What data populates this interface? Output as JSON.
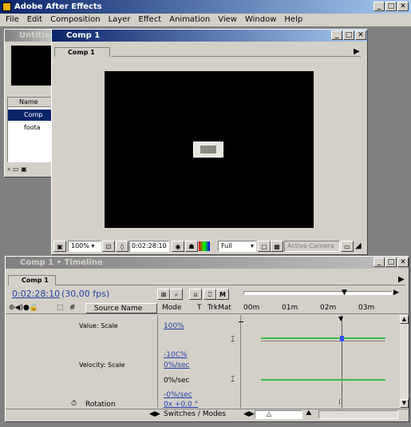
{
  "app": {
    "title": "Adobe After Effects"
  },
  "menu": [
    "File",
    "Edit",
    "Composition",
    "Layer",
    "Effect",
    "Animation",
    "View",
    "Window",
    "Help"
  ],
  "project": {
    "title": "Untitled",
    "col_name": "Name",
    "items": [
      "Comp",
      "foota"
    ]
  },
  "comp_window": {
    "title": "Comp 1",
    "tab": "Comp 1",
    "zoom": "100%",
    "timecode": "0:02:28:10",
    "resolution": "Full",
    "camera": "Active Camera"
  },
  "timeline": {
    "title": "Comp 1 • Timeline",
    "tab": "Comp 1",
    "current_time": "0:02:28:10",
    "fps": "(30,00 fps)",
    "headers": {
      "hash": "#",
      "source": "Source Name",
      "mode": "Mode",
      "t": "T",
      "trkmat": "TrkMat"
    },
    "ruler": [
      "00m",
      "01m",
      "02m",
      "03m"
    ],
    "rows": {
      "value_scale": {
        "label": "Value: Scale",
        "value": "100%"
      },
      "velocity_scale": {
        "label": "Velocity: Scale",
        "v1": "-10C%",
        "v2": "0%/sec",
        "v3": "0%/sec"
      },
      "rotation": {
        "label": "Rotation",
        "v1": "-0%/sec",
        "v2": "0x +0.0 °"
      }
    },
    "footer": "Switches / Modes"
  },
  "colors": {
    "title_active": "#0a246a",
    "curve": "#3cb846",
    "value_text": "#1f3ea8"
  }
}
